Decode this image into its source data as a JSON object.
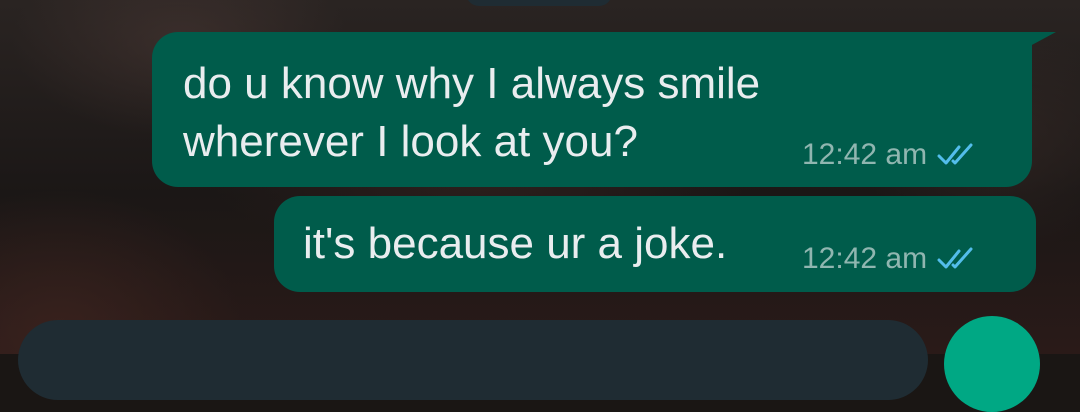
{
  "messages": [
    {
      "text": "do u know why I always smile\nwherever I look at you?",
      "time": "12:42 am",
      "status": "read",
      "direction": "outgoing"
    },
    {
      "text": "it's because ur a joke.",
      "time": "12:42 am",
      "status": "read",
      "direction": "outgoing"
    }
  ],
  "colors": {
    "bubble_outgoing": "#005c4b",
    "read_ticks": "#53bdeb",
    "send_button": "#00a884",
    "input_bar": "#1f2c33"
  },
  "icons": {
    "read_receipt": "double-check-icon"
  }
}
